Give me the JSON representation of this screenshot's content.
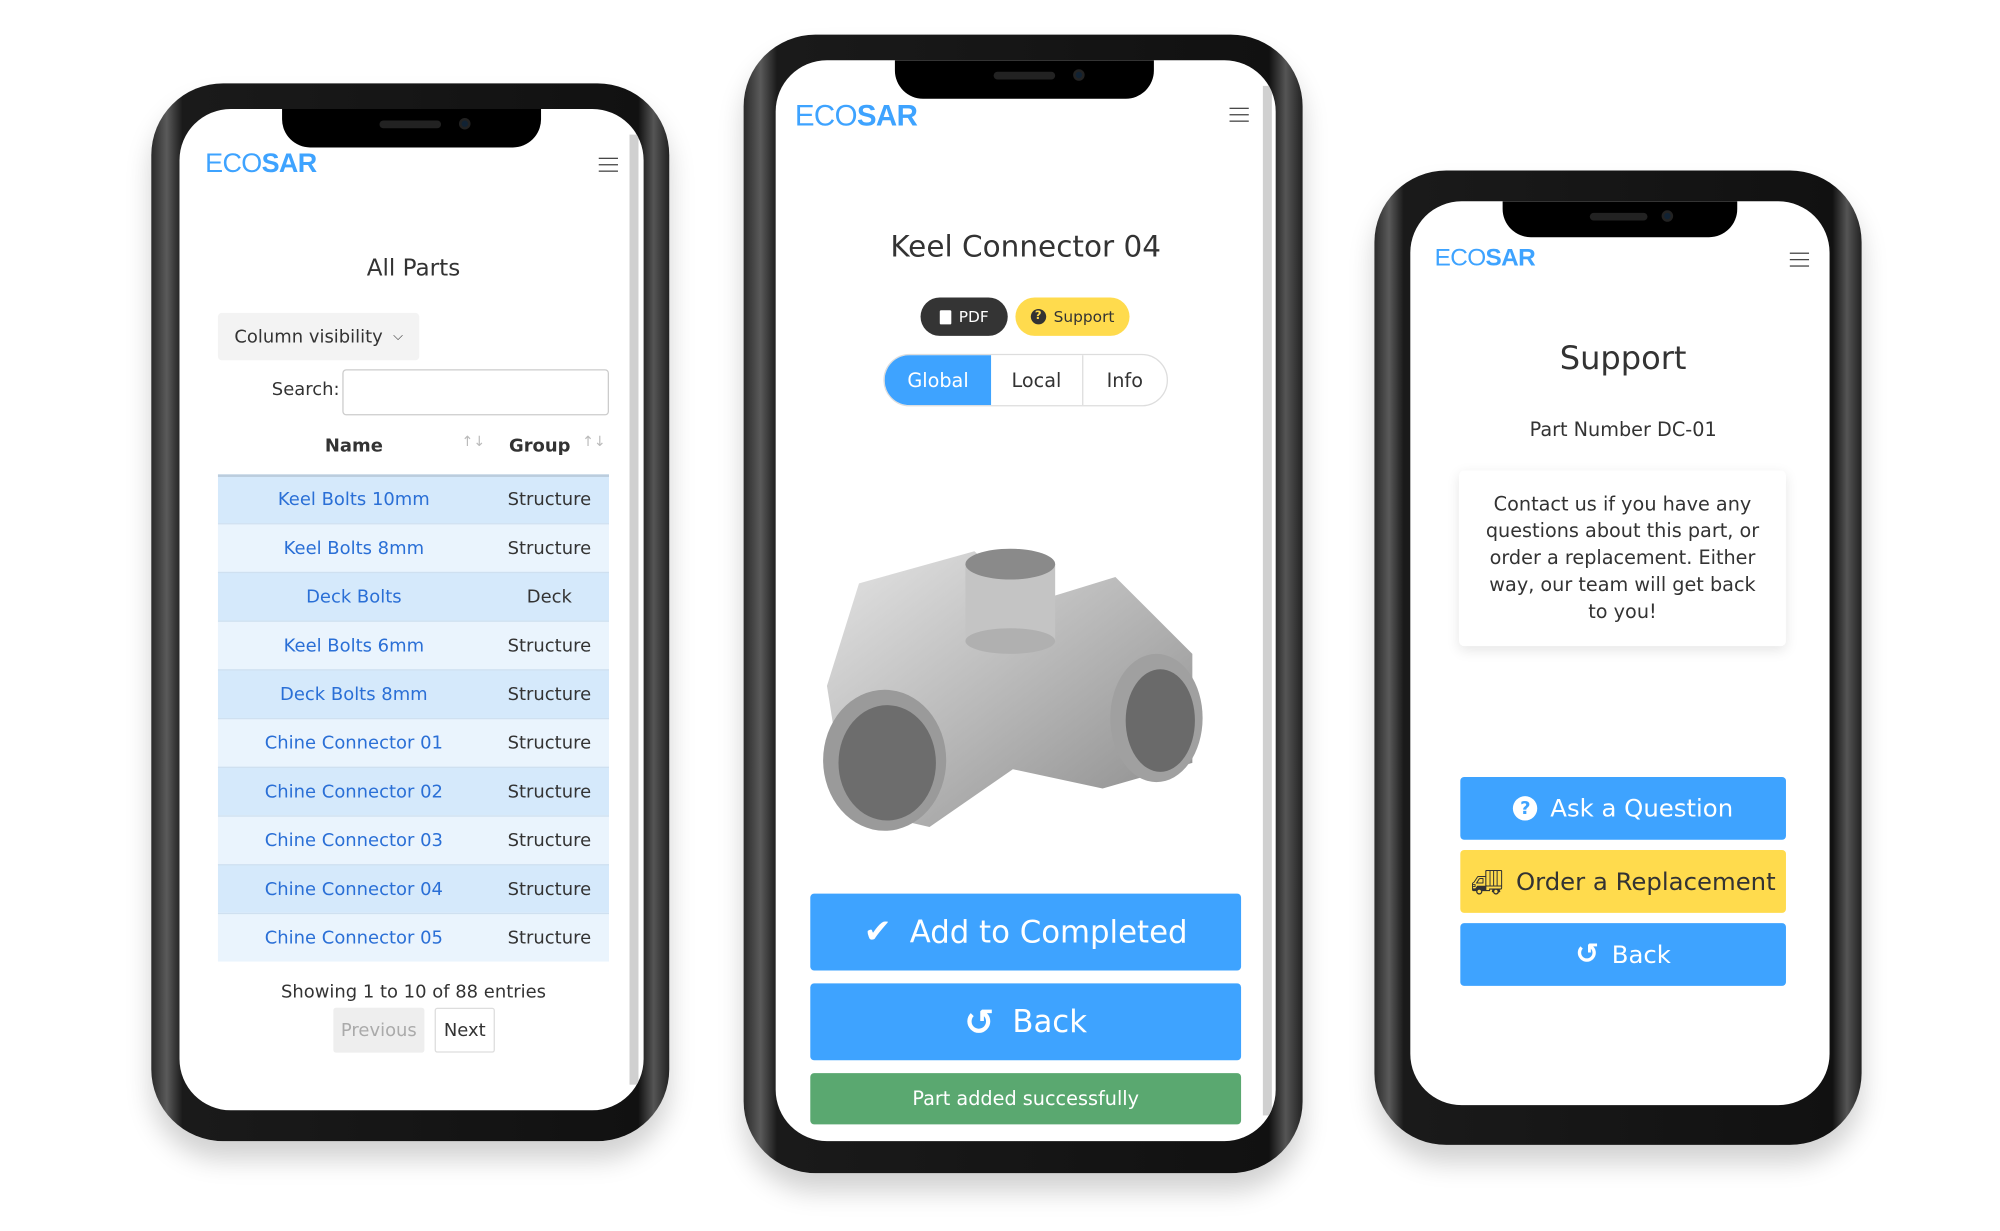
{
  "brand": {
    "logo_light": "ECO",
    "logo_bold": "SAR",
    "color": "#3ea3ff"
  },
  "parts_list": {
    "title": "All Parts",
    "column_visibility": "Column visibility",
    "search_label": "Search:",
    "search_value": "",
    "columns": [
      "Name",
      "Group"
    ],
    "rows": [
      {
        "name": "Keel Bolts 10mm",
        "group": "Structure"
      },
      {
        "name": "Keel Bolts 8mm",
        "group": "Structure"
      },
      {
        "name": "Deck Bolts",
        "group": "Deck"
      },
      {
        "name": "Keel Bolts 6mm",
        "group": "Structure"
      },
      {
        "name": "Deck Bolts 8mm",
        "group": "Structure"
      },
      {
        "name": "Chine Connector 01",
        "group": "Structure"
      },
      {
        "name": "Chine Connector 02",
        "group": "Structure"
      },
      {
        "name": "Chine Connector 03",
        "group": "Structure"
      },
      {
        "name": "Chine Connector 04",
        "group": "Structure"
      },
      {
        "name": "Chine Connector 05",
        "group": "Structure"
      }
    ],
    "info": "Showing 1 to 10 of 88 entries",
    "previous": "Previous",
    "next": "Next"
  },
  "part_detail": {
    "title": "Keel Connector 04",
    "pdf": "PDF",
    "support": "Support",
    "tabs": [
      {
        "label": "Global",
        "active": true
      },
      {
        "label": "Local",
        "active": false
      },
      {
        "label": "Info",
        "active": false
      }
    ],
    "add_completed": "Add to Completed",
    "back": "Back",
    "toast": "Part added successfully"
  },
  "support_page": {
    "title": "Support",
    "part_number": "Part Number DC-01",
    "message": "Contact us if you have any questions about this part, or order a replacement. Either way, our team will get back to you!",
    "ask": "Ask a Question",
    "order": "Order a Replacement",
    "back": "Back"
  },
  "colors": {
    "primary": "#3ea3ff",
    "warning": "#ffdb4d",
    "success": "#5aa870",
    "dark": "#343434"
  }
}
